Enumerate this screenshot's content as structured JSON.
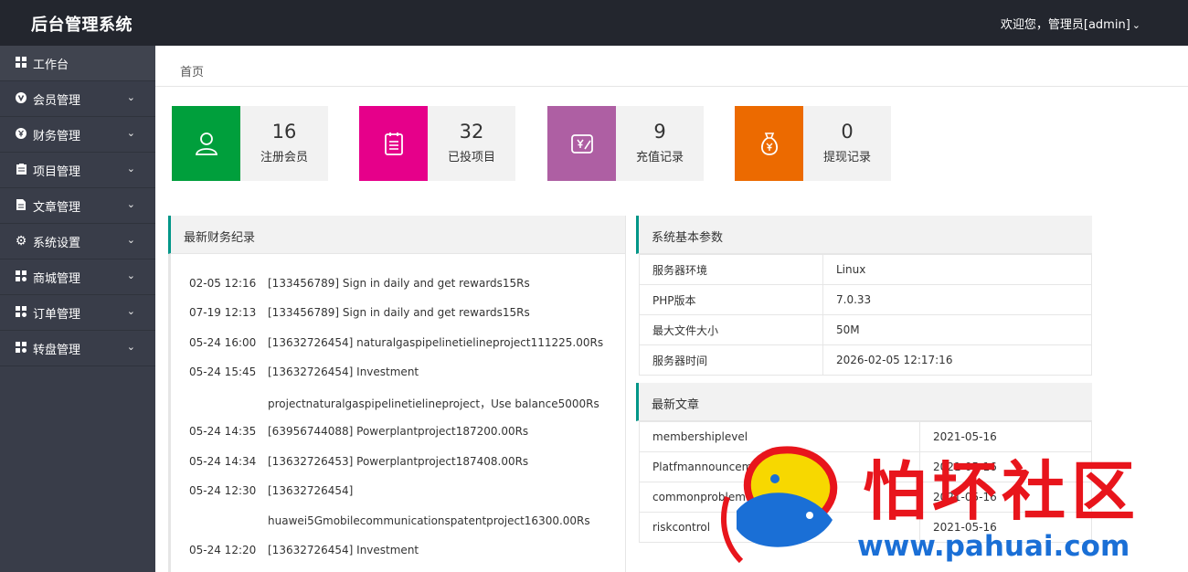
{
  "app": {
    "title": "后台管理系统"
  },
  "header": {
    "user_label": "欢迎您，管理员[admin]"
  },
  "sidebar": {
    "items": [
      {
        "label": "工作台"
      },
      {
        "label": "会员管理"
      },
      {
        "label": "财务管理"
      },
      {
        "label": "项目管理"
      },
      {
        "label": "文章管理"
      },
      {
        "label": "系统设置"
      },
      {
        "label": "商城管理"
      },
      {
        "label": "订单管理"
      },
      {
        "label": "转盘管理"
      }
    ]
  },
  "breadcrumb": {
    "home": "首页"
  },
  "stats": [
    {
      "value": "16",
      "label": "注册会员",
      "color": "#009f3c",
      "icon": "user-icon"
    },
    {
      "value": "32",
      "label": "已投项目",
      "color": "#e6008a",
      "icon": "clipboard-icon"
    },
    {
      "value": "9",
      "label": "充值记录",
      "color": "#ae5fa3",
      "icon": "recharge-icon"
    },
    {
      "value": "0",
      "label": "提现记录",
      "color": "#ec6a00",
      "icon": "money-bag-icon"
    }
  ],
  "finance": {
    "title": "最新财务纪录",
    "rows": [
      {
        "time": "02-05 12:16",
        "text": "[133456789] Sign in daily and get rewards15Rs"
      },
      {
        "time": "07-19 12:13",
        "text": "[133456789] Sign in daily and get rewards15Rs"
      },
      {
        "time": "05-24 16:00",
        "text": "[13632726454] naturalgaspipelinetielineproject111225.00Rs"
      },
      {
        "time": "05-24 15:45",
        "text": "[13632726454] Investment",
        "cont": "projectnaturalgaspipelinetielineproject，Use balance5000Rs"
      },
      {
        "time": "05-24 14:35",
        "text": "[63956744088] Powerplantproject187200.00Rs"
      },
      {
        "time": "05-24 14:34",
        "text": "[13632726453] Powerplantproject187408.00Rs"
      },
      {
        "time": "05-24 12:30",
        "text": "[13632726454]",
        "cont": "huawei5Gmobilecommunicationspatentproject16300.00Rs"
      },
      {
        "time": "05-24 12:20",
        "text": "[13632726454] Investment"
      }
    ]
  },
  "system": {
    "title": "系统基本参数",
    "rows": [
      {
        "key": "服务器环境",
        "value": "Linux"
      },
      {
        "key": "PHP版本",
        "value": "7.0.33"
      },
      {
        "key": "最大文件大小",
        "value": "50M"
      },
      {
        "key": "服务器时间",
        "value": "2026-02-05 12:17:16"
      }
    ]
  },
  "articles": {
    "title": "最新文章",
    "rows": [
      {
        "title": "membershiplevel",
        "date": "2021-05-16"
      },
      {
        "title": "Platfmannouncement",
        "date": "2021-05-16"
      },
      {
        "title": "commonproblem",
        "date": "2021-05-16"
      },
      {
        "title": "riskcontrol",
        "date": "2021-05-16"
      }
    ]
  },
  "watermark": {
    "text": "怕坏社区",
    "url": "www.pahuai.com"
  }
}
